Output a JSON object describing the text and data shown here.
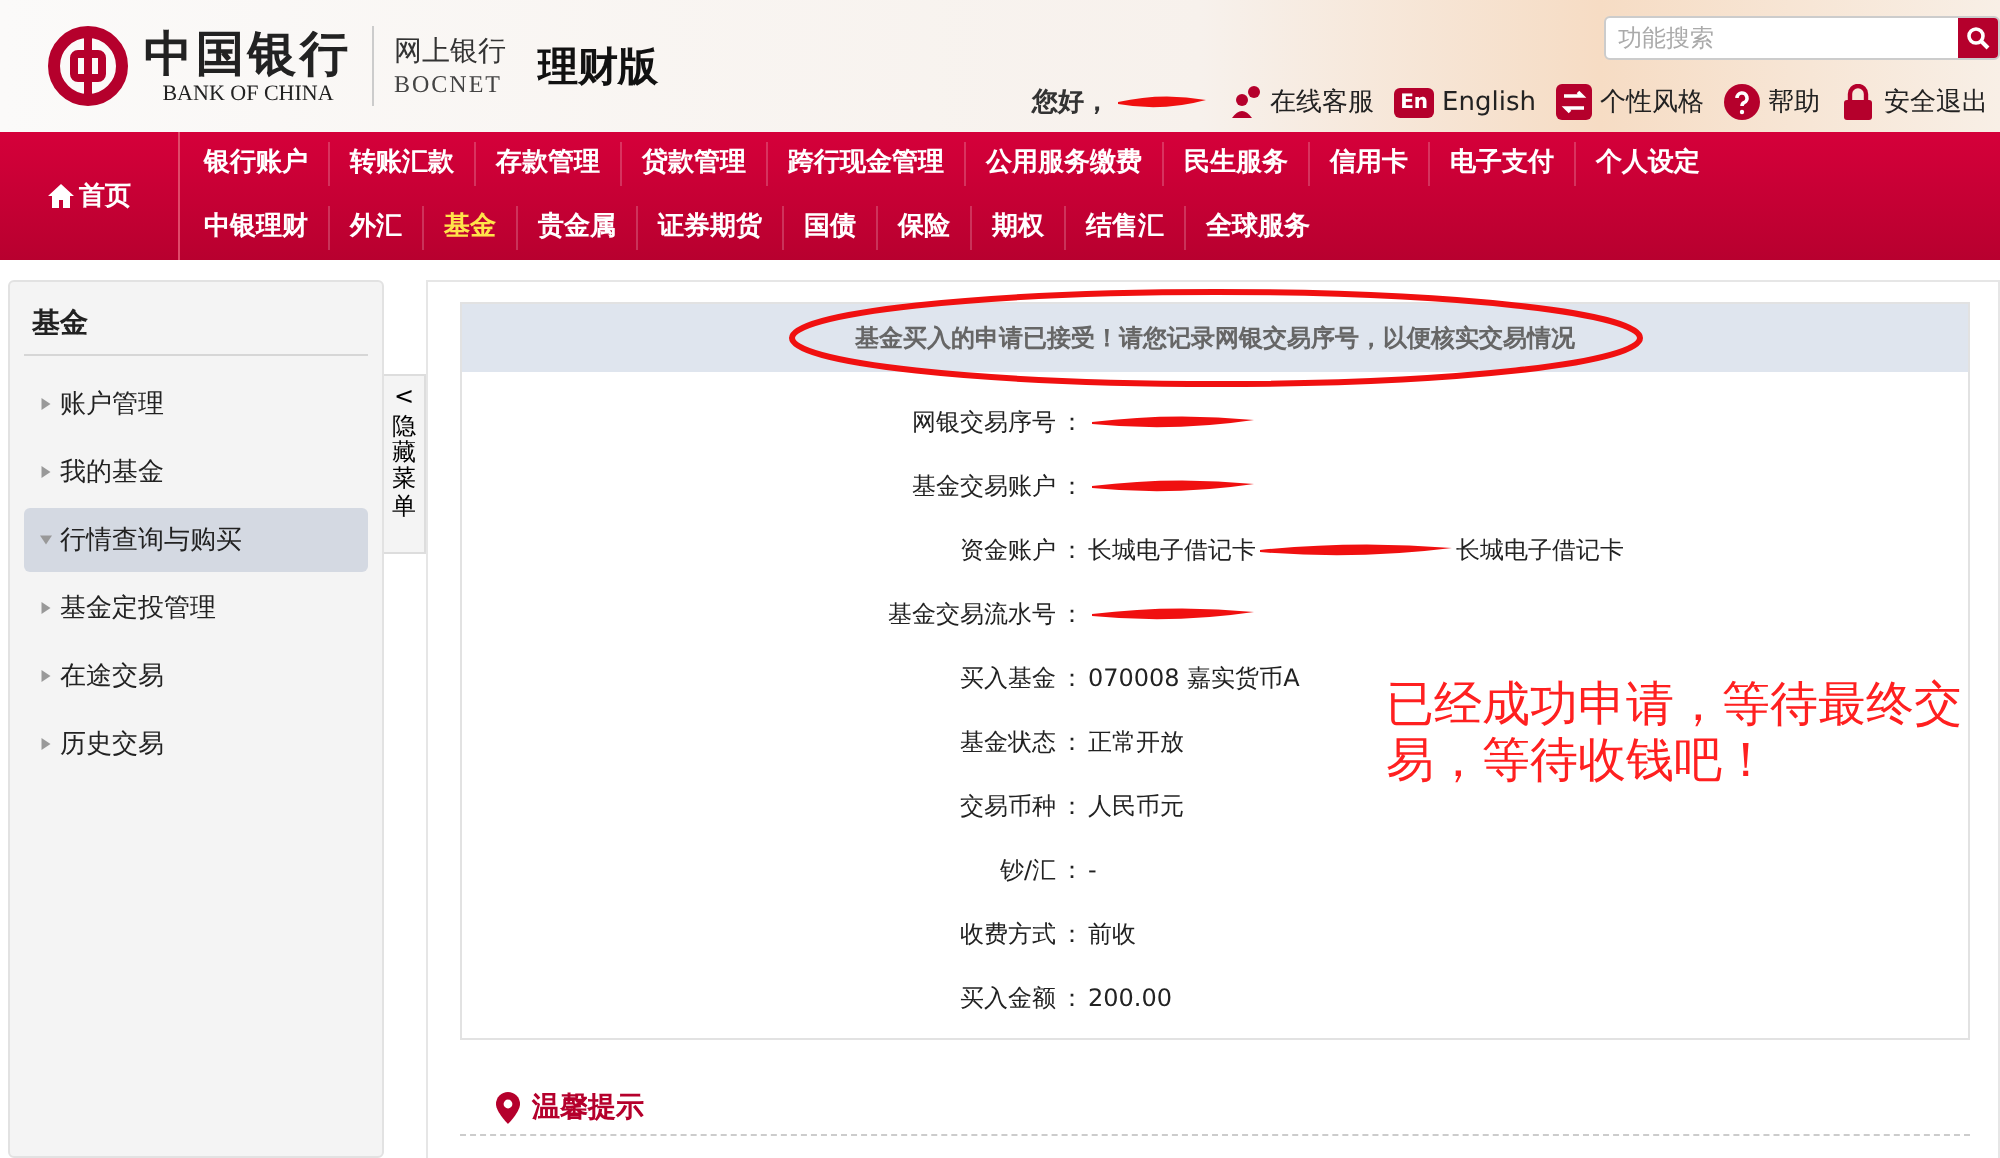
{
  "header": {
    "logo_cn": "中国银行",
    "logo_en": "BANK OF CHINA",
    "product_cn": "网上银行",
    "product_en": "BOCNET",
    "edition": "理财版",
    "search": {
      "placeholder": "功能搜索"
    },
    "greeting": "您好，",
    "username_redacted": true,
    "links": [
      {
        "kind": "service",
        "label": "在线客服"
      },
      {
        "kind": "english",
        "label": "English",
        "badge": "En"
      },
      {
        "kind": "style",
        "label": "个性风格"
      },
      {
        "kind": "help",
        "label": "帮助"
      },
      {
        "kind": "logout",
        "label": "安全退出"
      }
    ]
  },
  "nav": {
    "home": "首页",
    "rows": [
      {
        "items": [
          {
            "label": "银行账户",
            "selected": false
          },
          {
            "label": "转账汇款",
            "selected": false
          },
          {
            "label": "存款管理",
            "selected": false
          },
          {
            "label": "贷款管理",
            "selected": false
          },
          {
            "label": "跨行现金管理",
            "selected": false
          },
          {
            "label": "公用服务缴费",
            "selected": false
          },
          {
            "label": "民生服务",
            "selected": false
          },
          {
            "label": "信用卡",
            "selected": false
          },
          {
            "label": "电子支付",
            "selected": false
          },
          {
            "label": "个人设定",
            "selected": false
          }
        ]
      },
      {
        "items": [
          {
            "label": "中银理财",
            "selected": false
          },
          {
            "label": "外汇",
            "selected": false
          },
          {
            "label": "基金",
            "selected": true
          },
          {
            "label": "贵金属",
            "selected": false
          },
          {
            "label": "证券期货",
            "selected": false
          },
          {
            "label": "国债",
            "selected": false
          },
          {
            "label": "保险",
            "selected": false
          },
          {
            "label": "期权",
            "selected": false
          },
          {
            "label": "结售汇",
            "selected": false
          },
          {
            "label": "全球服务",
            "selected": false
          }
        ]
      }
    ]
  },
  "sidebar": {
    "title": "基金",
    "items": [
      {
        "label": "账户管理",
        "selected": false
      },
      {
        "label": "我的基金",
        "selected": false
      },
      {
        "label": "行情查询与购买",
        "selected": true
      },
      {
        "label": "基金定投管理",
        "selected": false
      },
      {
        "label": "在途交易",
        "selected": false
      },
      {
        "label": "历史交易",
        "selected": false
      }
    ],
    "toggle": {
      "arrow": "<",
      "label": "隐藏菜单"
    }
  },
  "result": {
    "message": "基金买入的申请已接受！请您记录网银交易序号，以便核实交易情况",
    "message_circled": true,
    "fields": [
      {
        "label": "网银交易序号",
        "colon": "：",
        "redacted": true
      },
      {
        "label": "基金交易账户",
        "colon": "：",
        "redacted": true
      },
      {
        "label": "资金账户",
        "colon": "：",
        "value": "长城电子借记卡",
        "redacted": true,
        "value_after": "长城电子借记卡"
      },
      {
        "label": "基金交易流水号",
        "colon": "：",
        "redacted": true
      },
      {
        "label": "买入基金",
        "colon": "：",
        "value": "070008 嘉实货币A",
        "redacted": false
      },
      {
        "label": "基金状态",
        "colon": "：",
        "value": "正常开放",
        "redacted": false
      },
      {
        "label": "交易币种",
        "colon": "：",
        "value": "人民币元",
        "redacted": false
      },
      {
        "label": "钞/汇",
        "colon": "：",
        "value": "-",
        "redacted": false
      },
      {
        "label": "收费方式",
        "colon": "：",
        "value": "前收",
        "redacted": false
      },
      {
        "label": "买入金额",
        "colon": "：",
        "value": "200.00",
        "redacted": false
      }
    ],
    "annotation": "已经成功申请，等待最终交易，等待收钱吧！"
  },
  "tips": {
    "title": "温馨提示"
  }
}
